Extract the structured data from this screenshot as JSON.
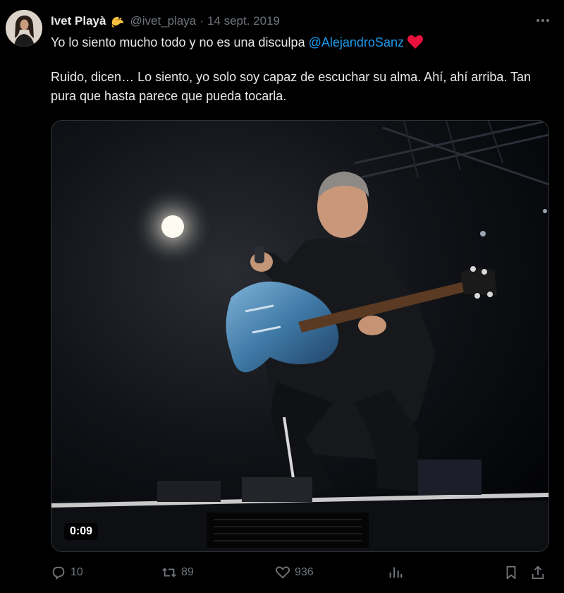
{
  "author": {
    "display_name": "Ivet Playà",
    "handle": "@ivet_playa",
    "date": "14 sept. 2019",
    "badge_icon": "dragon-emoji-icon"
  },
  "tweet": {
    "line1_text": "Yo lo siento mucho todo y no es una disculpa",
    "line1_mention": "@AlejandroSanz",
    "line2_text": "Ruido, dicen… Lo siento, yo solo soy capaz de escuchar su alma. Ahí, ahí arriba. Tan pura que hasta parece que pueda tocarla."
  },
  "media": {
    "type": "video",
    "duration": "0:09"
  },
  "actions": {
    "replies": "10",
    "reposts": "89",
    "likes": "936"
  },
  "colors": {
    "background": "#000000",
    "text": "#e7e9ea",
    "muted": "#71767b",
    "link": "#1d9bf0",
    "heart": "#f91880"
  }
}
